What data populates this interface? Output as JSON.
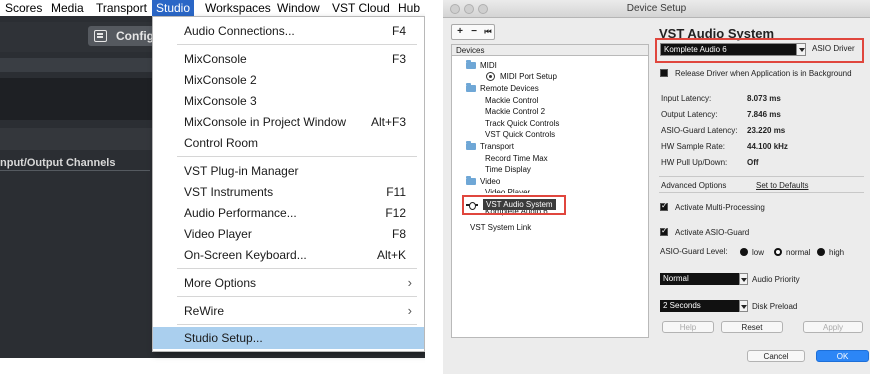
{
  "menubar": {
    "items": [
      "Scores",
      "Media",
      "Transport",
      "Studio",
      "Workspaces",
      "Window",
      "VST Cloud",
      "Hub"
    ],
    "active": "Studio"
  },
  "project": {
    "config_button": "Configu",
    "io_channels_label": "nput/Output Channels"
  },
  "studio_menu": {
    "items": [
      {
        "label": "Audio Connections...",
        "shortcut": "F4"
      },
      {
        "label": "MixConsole",
        "shortcut": "F3"
      },
      {
        "label": "MixConsole 2",
        "shortcut": ""
      },
      {
        "label": "MixConsole 3",
        "shortcut": ""
      },
      {
        "label": "MixConsole in Project Window",
        "shortcut": "Alt+F3"
      },
      {
        "label": "Control Room",
        "shortcut": ""
      },
      {
        "label": "VST Plug-in Manager",
        "shortcut": ""
      },
      {
        "label": "VST Instruments",
        "shortcut": "F11"
      },
      {
        "label": "Audio Performance...",
        "shortcut": "F12"
      },
      {
        "label": "Video Player",
        "shortcut": "F8"
      },
      {
        "label": "On-Screen Keyboard...",
        "shortcut": "Alt+K"
      },
      {
        "label": "More Options",
        "shortcut": ""
      },
      {
        "label": "ReWire",
        "shortcut": ""
      },
      {
        "label": "Studio Setup...",
        "shortcut": ""
      }
    ],
    "submenu_arrow": "›"
  },
  "device_setup": {
    "window_title": "Device Setup",
    "toolbar": {
      "add": "+",
      "remove": "−",
      "reset": "⏮"
    },
    "devices_header": "Devices",
    "tree": [
      {
        "label": "MIDI"
      },
      {
        "label": "MIDI Port Setup"
      },
      {
        "label": "Remote Devices"
      },
      {
        "label": "Mackie Control"
      },
      {
        "label": "Mackie Control 2"
      },
      {
        "label": "Track Quick Controls"
      },
      {
        "label": "VST Quick Controls"
      },
      {
        "label": "Transport"
      },
      {
        "label": "Record Time Max"
      },
      {
        "label": "Time Display"
      },
      {
        "label": "Video"
      },
      {
        "label": "Video Player"
      },
      {
        "label": "VST Audio System"
      },
      {
        "label": "Komplete Audio 6"
      },
      {
        "label": "VST System Link"
      }
    ],
    "panel_title": "VST Audio System",
    "asio_driver": {
      "value": "Komplete Audio 6",
      "button": "ASIO Driver"
    },
    "release_driver_label": "Release Driver when Application is in Background",
    "info": [
      {
        "label": "Input Latency:",
        "value": "8.073 ms"
      },
      {
        "label": "Output Latency:",
        "value": "7.846 ms"
      },
      {
        "label": "ASIO-Guard Latency:",
        "value": "23.220 ms"
      },
      {
        "label": "HW Sample Rate:",
        "value": "44.100 kHz"
      },
      {
        "label": "HW Pull Up/Down:",
        "value": "Off"
      }
    ],
    "tabs": {
      "advanced": "Advanced Options",
      "defaults": "Set to Defaults"
    },
    "multi_processing_label": "Activate Multi-Processing",
    "asio_guard_label": "Activate ASIO-Guard",
    "asio_guard_level": {
      "label": "ASIO-Guard Level:",
      "low": "low",
      "normal": "normal",
      "high": "high",
      "selected": "normal"
    },
    "audio_priority": {
      "value": "Normal",
      "label": "Audio Priority"
    },
    "disk_preload": {
      "value": "2 Seconds",
      "label": "Disk Preload"
    },
    "buttons": {
      "help": "Help",
      "reset": "Reset",
      "apply": "Apply",
      "cancel": "Cancel",
      "ok": "OK"
    }
  },
  "colors": {
    "menu_active": "#2a66c6",
    "menu_selected": "#aacfee",
    "highlight_box": "#e0463d",
    "ok_button": "#2c86f6"
  }
}
